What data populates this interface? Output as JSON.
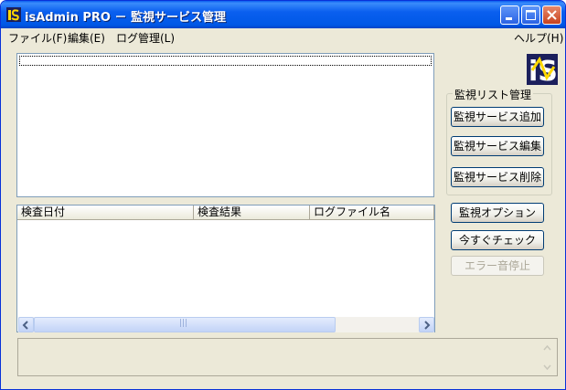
{
  "window": {
    "title": "isAdmin PRO － 監視サービス管理",
    "buttons": [
      "minimize",
      "maximize",
      "close"
    ]
  },
  "menu": [
    "ファイル(F)",
    "編集(E)",
    "ログ管理(L)",
    "ヘルプ(H)"
  ],
  "logo": {
    "text": "iS"
  },
  "watch_group": {
    "label": "監視リスト管理",
    "buttons": [
      "監視サービス追加",
      "監視サービス編集",
      "監視サービス削除"
    ]
  },
  "actions": {
    "options": "監視オプション",
    "check_now": "今すぐチェック",
    "stop_error_sound": "エラー音停止"
  },
  "log_list": {
    "columns": [
      "検査日付",
      "検査結果",
      "ログファイル名"
    ]
  },
  "scrollbar": {
    "thumb_grip": "|||"
  }
}
